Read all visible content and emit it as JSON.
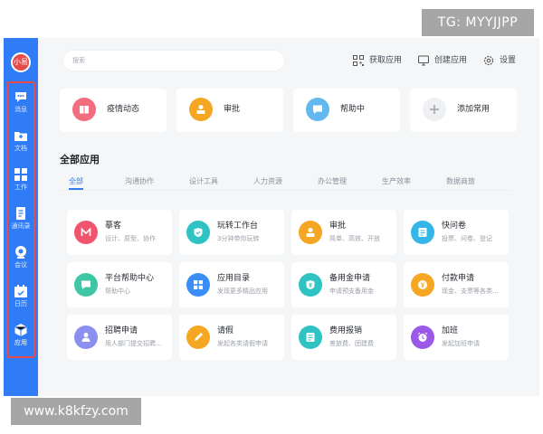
{
  "watermarks": {
    "telegram": "TG: MYYJJPP",
    "website": "www.k8kfzy.com"
  },
  "sidebar": {
    "logo_text": "小易",
    "items": [
      {
        "label": "消息",
        "icon": "chat-bubble-icon"
      },
      {
        "label": "文档",
        "icon": "folder-icon"
      },
      {
        "label": "工作",
        "icon": "grid-apps-icon"
      },
      {
        "label": "通讯录",
        "icon": "contacts-book-icon"
      },
      {
        "label": "会议",
        "icon": "camera-icon"
      },
      {
        "label": "日历",
        "icon": "calendar-icon"
      },
      {
        "label": "应用",
        "icon": "cube-icon"
      }
    ]
  },
  "header": {
    "search_placeholder": "搜索",
    "actions": [
      {
        "label": "获取应用",
        "icon": "scan-grid-icon"
      },
      {
        "label": "创建应用",
        "icon": "monitor-icon"
      },
      {
        "label": "设置",
        "icon": "gear-icon"
      }
    ]
  },
  "quick_apps": [
    {
      "label": "疫情动态",
      "icon": "book-icon",
      "color": "#f26d7d"
    },
    {
      "label": "审批",
      "icon": "stamp-icon",
      "color": "#f5a623"
    },
    {
      "label": "帮助中",
      "icon": "speech-bubble-icon",
      "color": "#64b8f0"
    },
    {
      "label": "添加常用",
      "icon": "plus-icon",
      "color": "#eef0f3"
    }
  ],
  "section": {
    "title": "全部应用",
    "tabs": [
      "全部",
      "沟通协作",
      "设计工具",
      "人力资源",
      "办公管理",
      "生产效率",
      "数据商旅"
    ]
  },
  "apps": [
    {
      "title": "摹客",
      "desc": "设计、原型、协作",
      "icon": "m-logo-icon",
      "color": "#f0556d"
    },
    {
      "title": "玩转工作台",
      "desc": "3分钟带你玩转",
      "icon": "shield-check-icon",
      "color": "#2fc3c3"
    },
    {
      "title": "审批",
      "desc": "简单、高效、开放",
      "icon": "stamp-icon",
      "color": "#f5a623"
    },
    {
      "title": "快问卷",
      "desc": "投票、问卷、登记",
      "icon": "questionnaire-icon",
      "color": "#35b6e8"
    },
    {
      "title": "平台帮助中心",
      "desc": "帮助中心",
      "icon": "speech-bubble-icon",
      "color": "#3fc6a6"
    },
    {
      "title": "应用目录",
      "desc": "发现更多精品应用",
      "icon": "grid-apps-icon",
      "color": "#3a8ef6"
    },
    {
      "title": "备用金申请",
      "desc": "申请预支备用金",
      "icon": "shield-yen-icon",
      "color": "#2fc3c3"
    },
    {
      "title": "付款申请",
      "desc": "现金、支票等各类...",
      "icon": "yen-coin-icon",
      "color": "#f5a623"
    },
    {
      "title": "招聘申请",
      "desc": "用人部门提交招聘...",
      "icon": "person-icon",
      "color": "#8a8ff0"
    },
    {
      "title": "请假",
      "desc": "发起各类请假申请",
      "icon": "pencil-icon",
      "color": "#f5a623"
    },
    {
      "title": "费用报销",
      "desc": "差旅费、团建费",
      "icon": "receipt-icon",
      "color": "#2fc3c3"
    },
    {
      "title": "加班",
      "desc": "发起加班申请",
      "icon": "alarm-clock-icon",
      "color": "#9b59e8"
    }
  ]
}
